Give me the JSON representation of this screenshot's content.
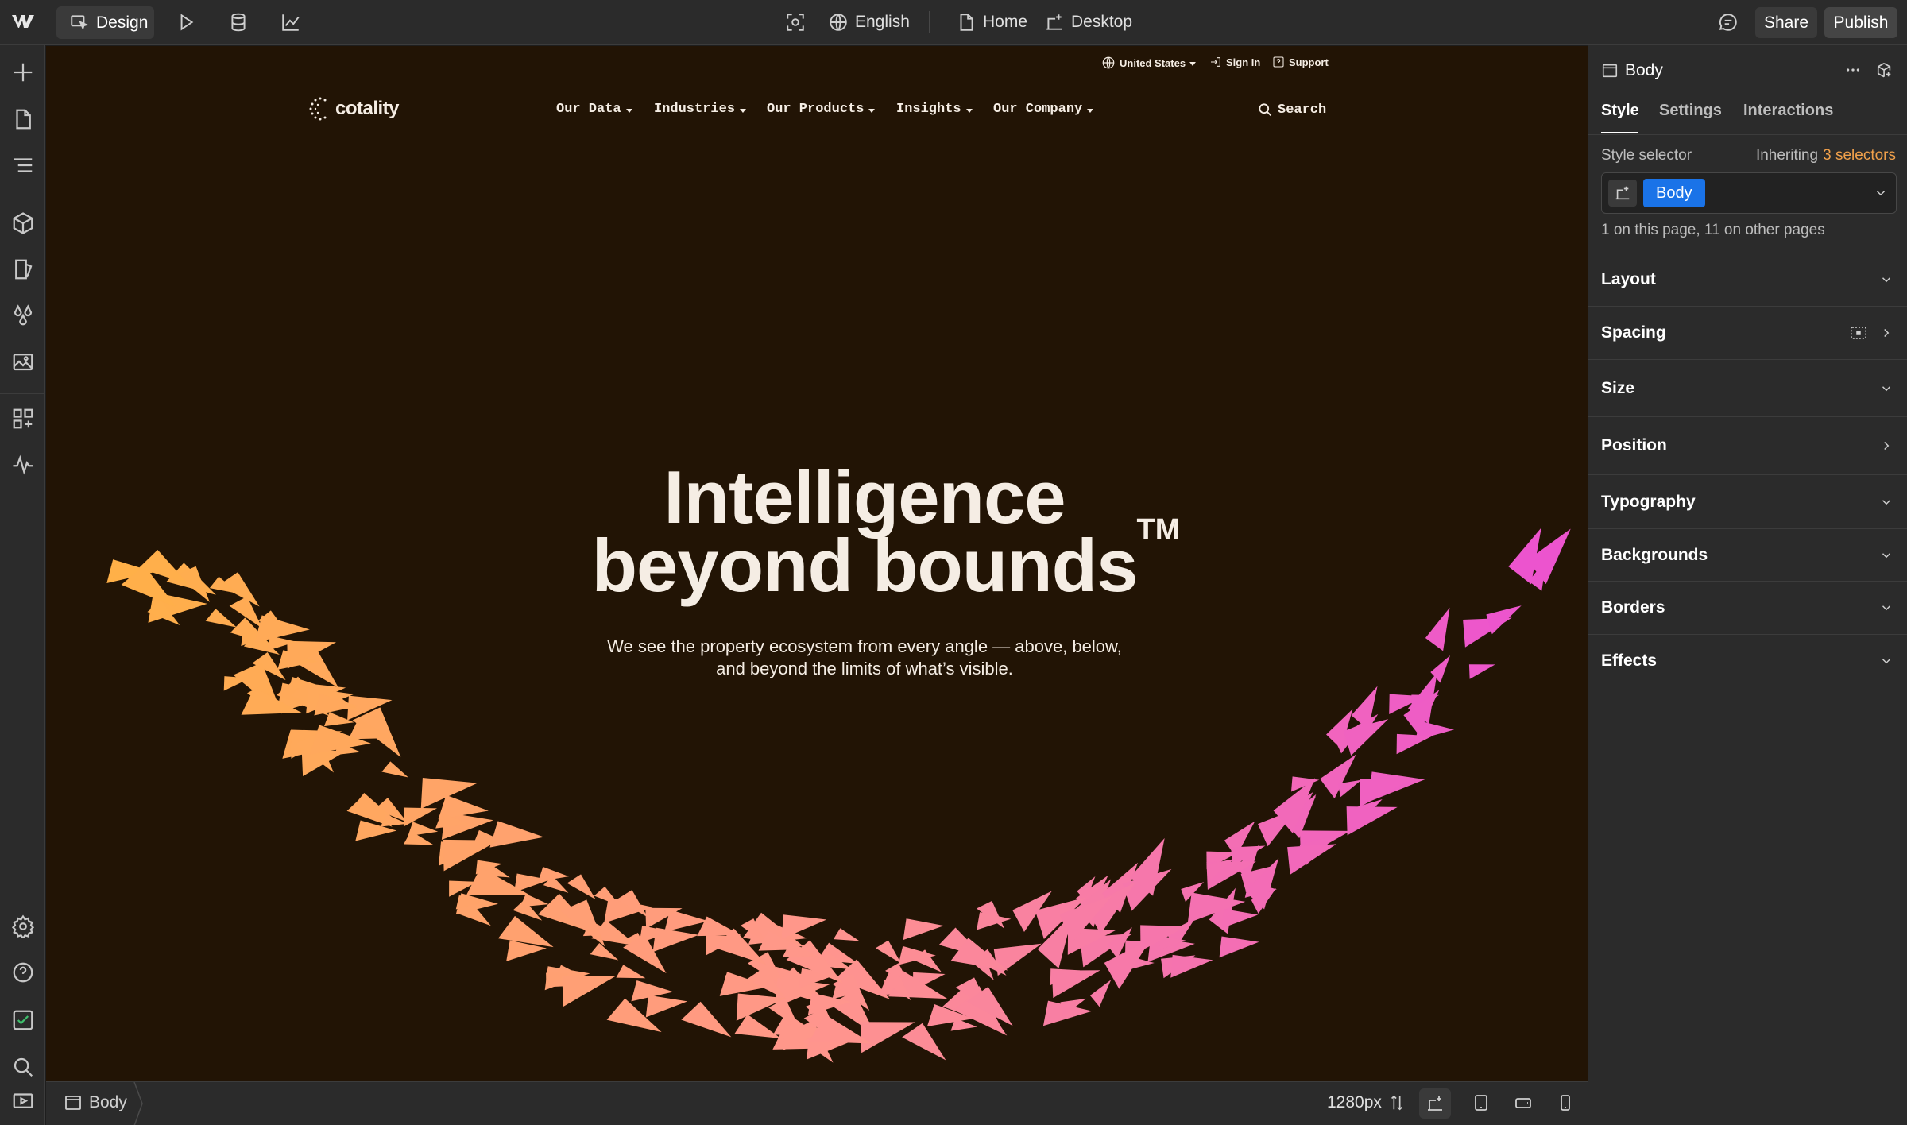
{
  "topbar": {
    "design_label": "Design",
    "locale_label": "English",
    "page_label": "Home",
    "breakpoint_label": "Desktop",
    "share_label": "Share",
    "publish_label": "Publish"
  },
  "site": {
    "utility": {
      "region": "United States",
      "sign_in": "Sign In",
      "support": "Support"
    },
    "logo_text": "cotality",
    "nav": [
      "Our Data",
      "Industries",
      "Our Products",
      "Insights",
      "Our Company"
    ],
    "search_label": "Search",
    "hero": {
      "title_line1": "Intelligence",
      "title_line2": "beyond bounds",
      "title_mark": "TM",
      "subtitle_line1": "We see the property ecosystem from every angle — above, below,",
      "subtitle_line2": "and beyond the limits of what’s visible."
    }
  },
  "bottombar": {
    "breadcrumb": "Body",
    "width_label": "1280px"
  },
  "panel": {
    "element_name": "Body",
    "tabs": [
      "Style",
      "Settings",
      "Interactions"
    ],
    "selector_label": "Style selector",
    "inheriting_prefix": "Inheriting",
    "inheriting_count": "3 selectors",
    "selector_chip": "Body",
    "usage_text": "1 on this page, 11 on other pages",
    "sections": [
      "Layout",
      "Spacing",
      "Size",
      "Position",
      "Typography",
      "Backgrounds",
      "Borders",
      "Effects"
    ]
  },
  "colors": {
    "accent": "#1a73e8",
    "inherit_orange": "#f0a04b",
    "canvas_bg": "#221405",
    "flock_orange": "#f5a84a",
    "flock_pink": "#e45ad0"
  }
}
